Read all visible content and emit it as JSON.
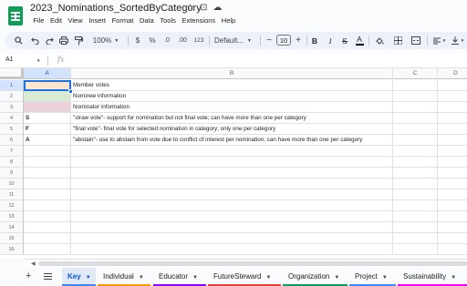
{
  "document": {
    "title": "2023_Nominations_SortedByCategory",
    "icons": [
      "star-icon",
      "move-folder-icon",
      "cloud-saved-icon"
    ]
  },
  "menu": [
    "File",
    "Edit",
    "View",
    "Insert",
    "Format",
    "Data",
    "Tools",
    "Extensions",
    "Help"
  ],
  "toolbar": {
    "zoom": "100%",
    "currency": "$",
    "percent": "%",
    "decrease_decimals": ".0",
    "increase_decimals": ".00",
    "more_formats": "123",
    "font_family": "Default...",
    "font_size": "10",
    "bold": "B",
    "italic": "I",
    "strikethrough": "S",
    "text_color": "A"
  },
  "formula_bar": {
    "cell_ref": "A1",
    "fx": "fx",
    "value": ""
  },
  "columns": [
    "A",
    "B",
    "C",
    "D"
  ],
  "rows": [
    {
      "num": "1",
      "a": "",
      "b": "Member votes",
      "a_color": "#fce5cd"
    },
    {
      "num": "2",
      "a": "",
      "b": "Nominee information",
      "a_color": "#d9ead3"
    },
    {
      "num": "3",
      "a": "",
      "b": "Nominator information",
      "a_color": "#ead1dc"
    },
    {
      "num": "4",
      "a": "S",
      "b": "\"straw vote\"- support for nomination but not final vote; can have more than one per category",
      "a_color": ""
    },
    {
      "num": "5",
      "a": "F",
      "b": "\"final vote\"- final vote for selected nomination in category; only one per category",
      "a_color": ""
    },
    {
      "num": "6",
      "a": "A",
      "b": "\"abstain\"- use to abstain from vote due to conflict of interest per nomination; can have more than one per category",
      "a_color": ""
    },
    {
      "num": "7",
      "a": "",
      "b": "",
      "a_color": ""
    },
    {
      "num": "8",
      "a": "",
      "b": "",
      "a_color": ""
    },
    {
      "num": "9",
      "a": "",
      "b": "",
      "a_color": ""
    },
    {
      "num": "10",
      "a": "",
      "b": "",
      "a_color": ""
    },
    {
      "num": "11",
      "a": "",
      "b": "",
      "a_color": ""
    },
    {
      "num": "12",
      "a": "",
      "b": "",
      "a_color": ""
    },
    {
      "num": "13",
      "a": "",
      "b": "",
      "a_color": ""
    },
    {
      "num": "14",
      "a": "",
      "b": "",
      "a_color": ""
    },
    {
      "num": "15",
      "a": "",
      "b": "",
      "a_color": ""
    },
    {
      "num": "16",
      "a": "",
      "b": "",
      "a_color": ""
    }
  ],
  "sheet_tabs": [
    {
      "label": "Key",
      "active": true,
      "color": "#4285f4"
    },
    {
      "label": "Individual",
      "active": false,
      "color": "#ff9900"
    },
    {
      "label": "Educator",
      "active": false,
      "color": "#9900ff"
    },
    {
      "label": "FutureSteward",
      "active": false,
      "color": "#ea4335"
    },
    {
      "label": "Organization",
      "active": false,
      "color": "#0f9d58"
    },
    {
      "label": "Project",
      "active": false,
      "color": "#4285f4"
    },
    {
      "label": "Sustainability",
      "active": false,
      "color": "#ff00ff"
    }
  ],
  "colors": {
    "accent": "#1a73e8",
    "toolbar_bg": "#edf2fa",
    "sheets_green": "#0f9d58"
  }
}
